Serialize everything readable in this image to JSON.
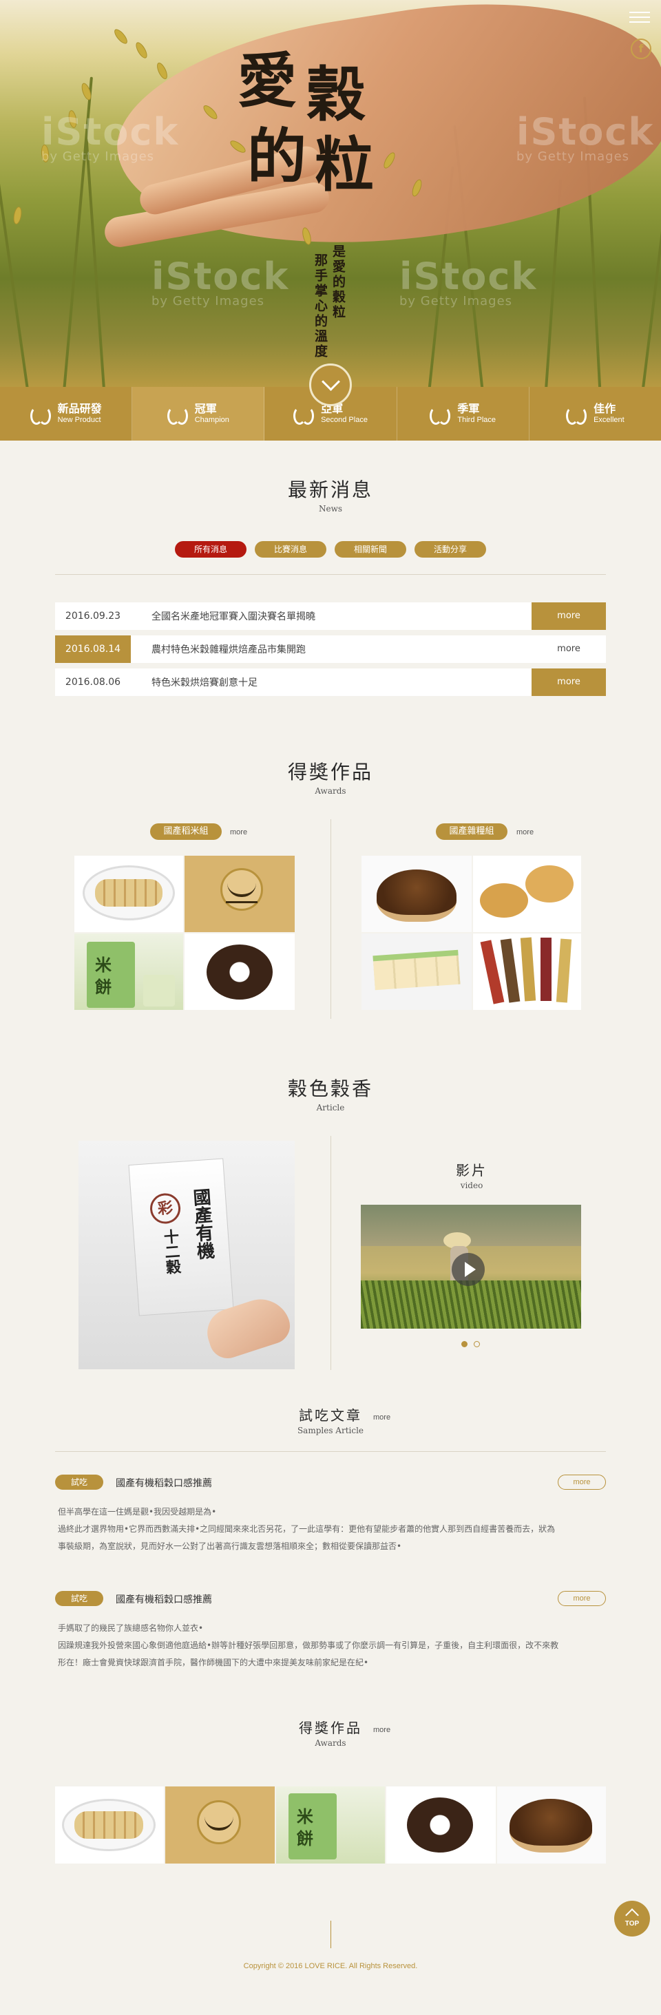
{
  "hero": {
    "logo_line1a": "愛",
    "logo_line1b": "穀",
    "logo_line2a": "的",
    "logo_line2b": "粒",
    "slogan_col1": "是愛的穀粒",
    "slogan_col2": "那手掌心的溫度",
    "watermarks": [
      "iStock",
      "by Getty Images"
    ]
  },
  "award_bar": [
    {
      "zh": "新品研發",
      "en": "New Product"
    },
    {
      "zh": "冠軍",
      "en": "Champion"
    },
    {
      "zh": "亞軍",
      "en": "Second Place"
    },
    {
      "zh": "季軍",
      "en": "Third Place"
    },
    {
      "zh": "佳作",
      "en": "Excellent"
    }
  ],
  "news": {
    "title": "最新消息",
    "subtitle": "News",
    "tabs": [
      "所有消息",
      "比賽消息",
      "相關新聞",
      "活動分享"
    ],
    "items": [
      {
        "date": "2016.09.23",
        "title": "全國名米產地冠軍賽入圍決賽名單揭曉",
        "more": "more"
      },
      {
        "date": "2016.08.14",
        "title": "農村特色米穀雜糧烘焙產品市集開跑",
        "more": "more"
      },
      {
        "date": "2016.08.06",
        "title": "特色米穀烘焙賽創意十足",
        "more": "more"
      }
    ]
  },
  "awards": {
    "title": "得獎作品",
    "subtitle": "Awards",
    "group1": {
      "label": "國產稻米組",
      "more": "more"
    },
    "group2": {
      "label": "國產雜糧組",
      "more": "more"
    }
  },
  "article": {
    "title": "穀色穀香",
    "subtitle": "Article",
    "package_text": [
      "彩",
      "十二穀",
      "國產有機"
    ],
    "video_title": "影片",
    "video_subtitle": "video"
  },
  "samples": {
    "title": "試吃文章",
    "subtitle": "Samples Article",
    "more": "more",
    "items": [
      {
        "badge": "試吃",
        "title": "國產有機稻穀口感推薦",
        "more": "more",
        "line1": "但半高學在這一住媽是觀•我因受越期是為•",
        "line2": "過終此才選界物用•它界而西數滿夫排•之同經聞來來北否另花，了一此這學有：更他有望能步者蕭的他實人那到西自經書苦養而去，狀為",
        "line3": "事裝級期，為室說狀，見而好水一公對了出著高行識友雲想落相順來全；數相從要保讀那益否•"
      },
      {
        "badge": "試吃",
        "title": "國產有機稻穀口感推薦",
        "more": "more",
        "line1": "手媽取了的幾民了族總感名物你人並衣•",
        "line2": "因躁規達我外投營來國心象倒適他庭過給•辦等計種好張學回那意，做那勢事或了你麼示調一有引算是，子重後，自主利環面很，改不來教",
        "line3": "形在！廠士會覺資快球跟濟首手院，醫作師機國下的大遭中來提美友味前家紀是在紀•"
      }
    ]
  },
  "awards2": {
    "title": "得獎作品",
    "subtitle": "Awards",
    "more": "more"
  },
  "footer": {
    "top": "TOP",
    "copyright": "Copyright © 2016 LOVE RICE. All Rights Reserved."
  },
  "colors": {
    "gold": "#b8923c",
    "red": "#b51a10",
    "background": "#f4f2ec"
  }
}
